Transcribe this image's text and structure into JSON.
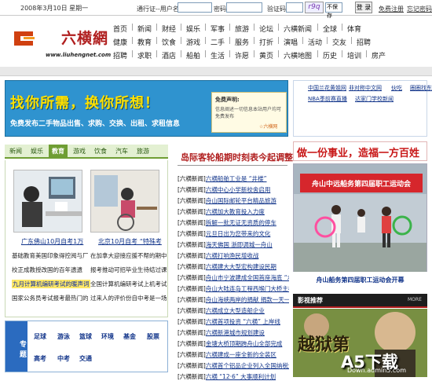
{
  "topbar": {
    "date": "2008年3月10日 星期一",
    "pass_label": "通行证--用户名：",
    "pwd_label": "密码：",
    "captcha_label": "验证码：",
    "captcha_code": "r9q",
    "remember_option": "不保存",
    "login_button": "登 录",
    "register_link": "免费注册",
    "forgot_link": "忘记密码"
  },
  "logo": {
    "name": "六横網",
    "url": "www.liuhengnet.com"
  },
  "nav": {
    "rows": [
      [
        "首页",
        "新闻",
        "财经",
        "娱乐",
        "军事",
        "旅游",
        "论坛",
        "六横新闻",
        "全球",
        "体育"
      ],
      [
        "健康",
        "教育",
        "饮食",
        "游戏",
        "二手",
        "服务",
        "打折",
        "演唱",
        "活动",
        "交友",
        "招聘"
      ],
      [
        "招聘",
        "求职",
        "酒店",
        "船舶",
        "生活",
        "许愿",
        "黄页",
        "六横地图",
        "历史",
        "培训",
        "房产"
      ]
    ]
  },
  "banner": {
    "headline": "找你所需，换你所想！",
    "subline": "免费发布二手物品出售、求购、交换、出租、求租信息",
    "note_title": "免费声明:",
    "note_body": "信息阐述一切信息本站用户均可免费发布",
    "note_sign": "☆六横网"
  },
  "right_links": [
    [
      "中国兰花黄姐网",
      "非对称中文网",
      "伙吃",
      "圈圈找东"
    ],
    [
      "NBA季前赛直播",
      "达家门学校新闻"
    ]
  ],
  "tabs": [
    "新闻",
    "娱乐",
    "教育",
    "游戏",
    "饮食",
    "汽车",
    "旅游"
  ],
  "left": {
    "photo_caps": [
      "广东佛山10月自考1万",
      "北京10月自考 “特殊考"
    ],
    "lines": [
      [
        "基础教育美国印象得控阅与厂",
        "在加拿大迎接应援不帮的期中"
      ],
      [
        "校正成教授改国的百年遗遗",
        "报考推动可招毕业生待结过课"
      ],
      [
        "九月计算机编研考试的暖声词",
        "全国计算机编研考试上机考试"
      ],
      [
        "国家公务员考试报考最热门的",
        "过来人的评价份自中考是一场"
      ]
    ]
  },
  "special": {
    "label": "专题",
    "keywords": [
      "足球",
      "游泳",
      "篮球",
      "环境",
      "基金",
      "股票",
      "高考",
      "中考",
      "交通"
    ]
  },
  "mid": {
    "title": "岛际客轮船期时刻表今起调整",
    "rows": [
      [
        "[六横新闻]",
        "六横船舶工业是 “井楼”"
      ],
      [
        "[六横新闻]",
        "六横中心小学新校舍启用"
      ],
      [
        "[六横新闻]",
        "舟山国际邮轮平台精品旅游"
      ],
      [
        "[六横新闻]",
        "六横加大教育投入力度"
      ],
      [
        "[六横新闻]",
        "拆解一批无证无资质的停车"
      ],
      [
        "[六横新闻]",
        "元旦日出为您带来的文化"
      ],
      [
        "[六横新闻]",
        "海天佛国 浙即调城一舟山"
      ],
      [
        "[六横新闻]",
        "六横打响渔民增收战"
      ],
      [
        "[六横新闻]",
        "六横建大大型宏构建设民期"
      ],
      [
        "[六横新闻]",
        "舟山市宁波建成全国首座海底 “水库”"
      ],
      [
        "[六横新闻]",
        "舟山大陆连岛工程西堠门大桥主桥"
      ],
      [
        "[六横新闻]",
        "舟山海峡两岸的捐献 捐款一天一次"
      ],
      [
        "[六横新闻]",
        "六横成立大型造船企业"
      ],
      [
        "[六横新闻]",
        "六横首项投资 “六横” 上岸线"
      ],
      [
        "[六横新闻]",
        "六横新港城市规划建设"
      ],
      [
        "[六横新闻]",
        "金塘大桥顶期跨舟山全部完成"
      ],
      [
        "[六横新闻]",
        "六横建成一座全新的全装区"
      ],
      [
        "[六横新闻]",
        "六横首个铝品企业列入全国纳税企业"
      ],
      [
        "[六横新闻]",
        "六横 “12·6” 大事顺利计划"
      ]
    ]
  },
  "right": {
    "headline": "做一份事业，造福一方百姓",
    "photo_sign": "舟山中远船务第四届职工运动会",
    "caption": "舟山船务第四届职工运动会开幕",
    "film_title": "影视推荐",
    "film_more": "MORE",
    "film_text": "越狱第",
    "watermark": "A5下载",
    "watermark_sub": "Down.admin5.com"
  },
  "colors": {
    "accent_red": "#b01e1e",
    "link_blue": "#11348a",
    "tab_green": "#6f9e34",
    "banner_blue": "#2f93cf"
  }
}
